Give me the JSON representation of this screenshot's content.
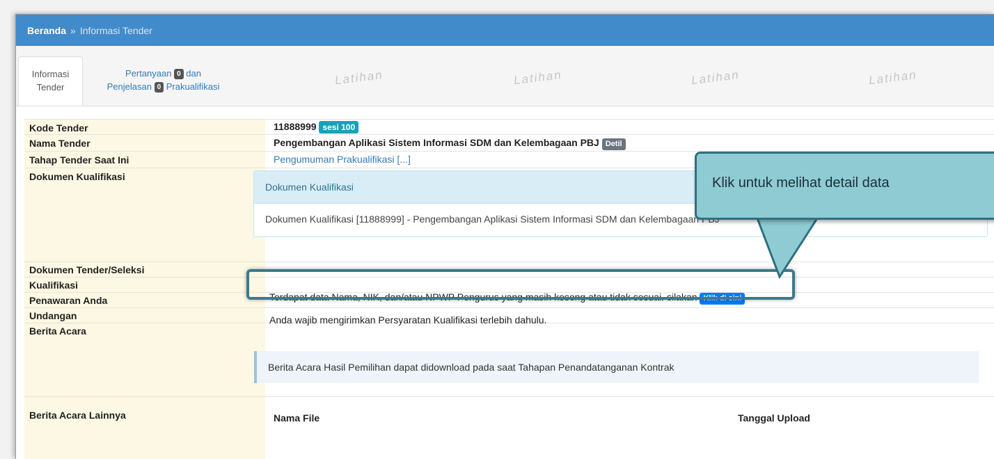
{
  "breadcrumb": {
    "home": "Beranda",
    "separator": "»",
    "current": "Informasi Tender"
  },
  "tabs": {
    "active": {
      "line1": "Informasi",
      "line2": "Tender"
    },
    "second": {
      "line1_prefix": "Pertanyaan",
      "line1_count": "0",
      "line1_suffix": "dan",
      "line2_prefix": "Penjelasan",
      "line2_count": "0",
      "line2_suffix": "Prakualifikasi"
    }
  },
  "watermark": "Latihan",
  "fields": {
    "kode": {
      "label": "Kode Tender",
      "value": "11888999",
      "badge": "sesi 100"
    },
    "nama": {
      "label": "Nama Tender",
      "value": "Pengembangan Aplikasi Sistem Informasi SDM dan Kelembagaan PBJ",
      "badge": "Detil"
    },
    "tahap": {
      "label": "Tahap Tender Saat Ini",
      "value": "Pengumuman Prakualifikasi [...]"
    },
    "dokumen_kualifikasi": {
      "label": "Dokumen Kualifikasi",
      "panel_title": "Dokumen Kualifikasi",
      "panel_body": "Dokumen Kualifikasi [11888999] - Pengembangan Aplikasi Sistem Informasi SDM dan Kelembagaan PBJ"
    },
    "dokumen_tender": {
      "label": "Dokumen Tender/Seleksi"
    },
    "kualifikasi": {
      "label": "Kualifikasi",
      "value": "Terdapat data Nama, NIK, dan/atau NPWP Pengurus yang masih kosong atau tidak sesuai. silakan",
      "button": "Klik di sini"
    },
    "penawaran": {
      "label": "Penawaran Anda",
      "value": "Anda wajib mengirimkan Persyaratan Kualifikasi terlebih dahulu."
    },
    "undangan": {
      "label": "Undangan"
    },
    "berita_acara": {
      "label": "Berita Acara",
      "alert": "Berita Acara Hasil Pemilihan dapat didownload pada saat Tahapan Penandatanganan Kontrak"
    },
    "berita_lainnya": {
      "label": "Berita Acara Lainnya",
      "col1": "Nama File",
      "col2": "Tanggal Upload"
    }
  },
  "callout": {
    "text": "Klik untuk melihat detail data"
  },
  "colors": {
    "topbar": "#428bca",
    "label_bg": "#fcf8e3",
    "callout_bg": "#8fcbd3",
    "callout_border": "#2f6f82"
  }
}
